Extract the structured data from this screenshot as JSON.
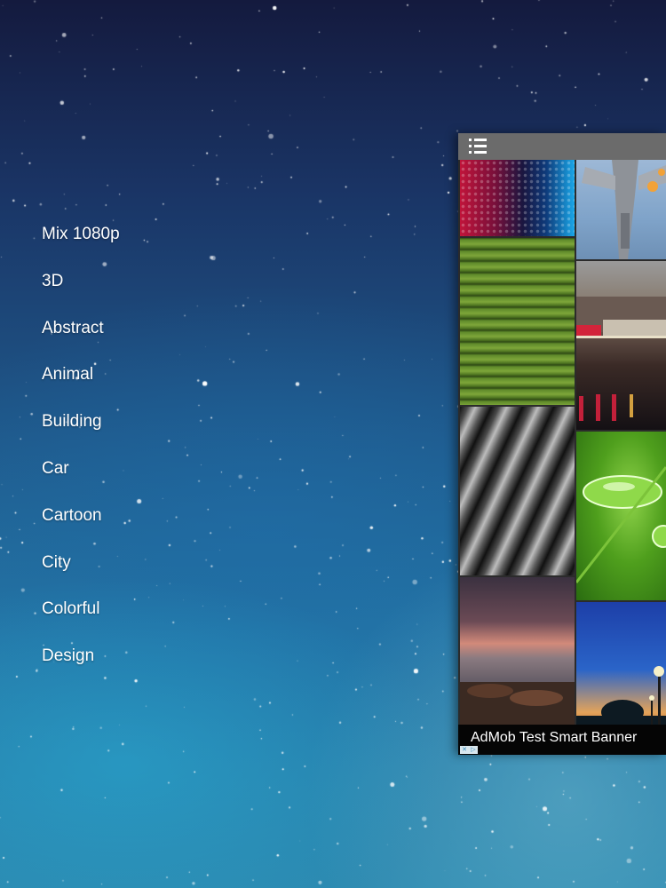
{
  "categories": [
    {
      "label": "Mix 1080p"
    },
    {
      "label": "3D"
    },
    {
      "label": "Abstract"
    },
    {
      "label": "Animal"
    },
    {
      "label": "Building"
    },
    {
      "label": "Car"
    },
    {
      "label": "Cartoon"
    },
    {
      "label": "City"
    },
    {
      "label": "Colorful"
    },
    {
      "label": "Design"
    }
  ],
  "panel": {
    "menu_icon": "list-menu-icon",
    "thumbnails": [
      {
        "name": "blue-red-dot-pattern"
      },
      {
        "name": "fighter-jet"
      },
      {
        "name": "green-bamboo"
      },
      {
        "name": "harbor-night-lights"
      },
      {
        "name": "black-white-leaves"
      },
      {
        "name": "water-drop-on-leaf"
      },
      {
        "name": "rocky-shore-sunset"
      },
      {
        "name": "street-lamp-dusk"
      }
    ]
  },
  "ad": {
    "banner_text": "AdMob Test Smart Banner"
  },
  "colors": {
    "header_bg": "#6b6b6b",
    "banner_bg": "#050505",
    "menu_text": "#ffffff"
  }
}
